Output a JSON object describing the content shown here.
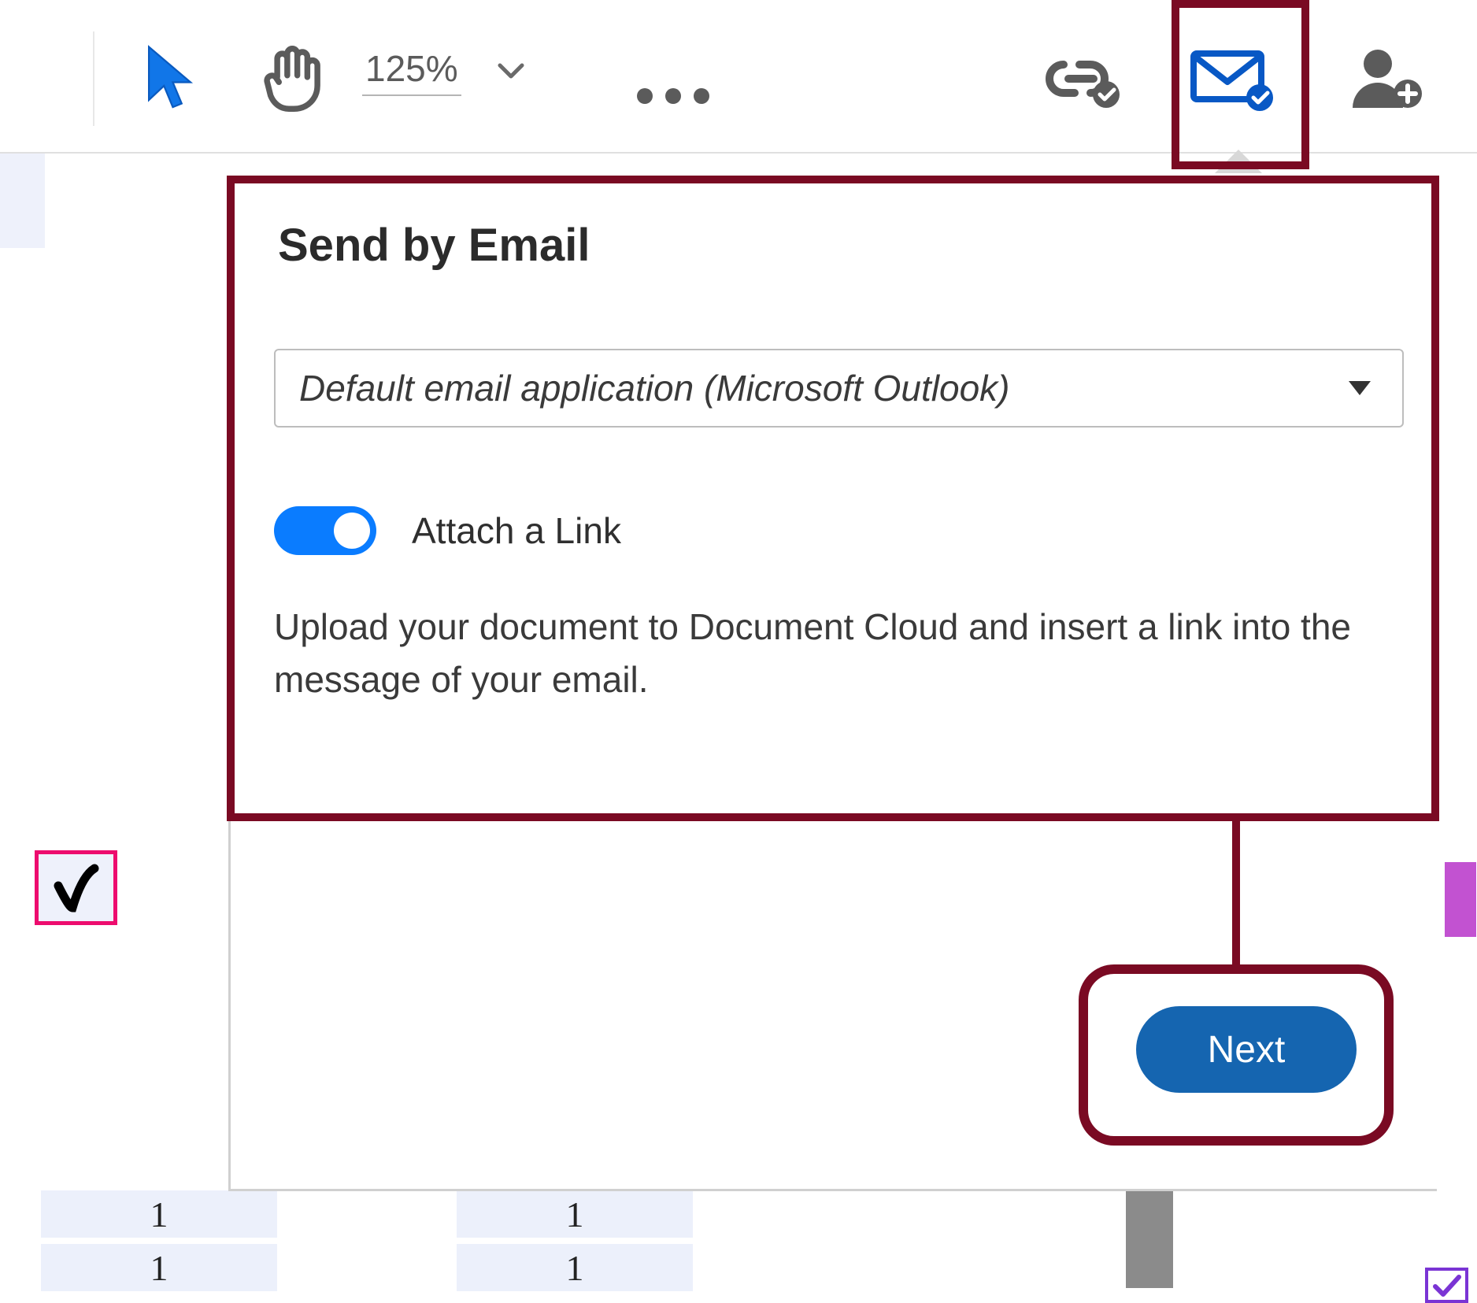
{
  "toolbar": {
    "zoom_value": "125%"
  },
  "panel": {
    "title": "Send by Email",
    "dropdown_value": "Default email application (Microsoft Outlook)",
    "toggle_label": "Attach a Link",
    "description": "Upload your document to Document Cloud and insert a link into the message of your email.",
    "next_label": "Next"
  },
  "doc": {
    "cell1": "1",
    "cell2": "1",
    "cell3": "1",
    "cell4": "1"
  }
}
